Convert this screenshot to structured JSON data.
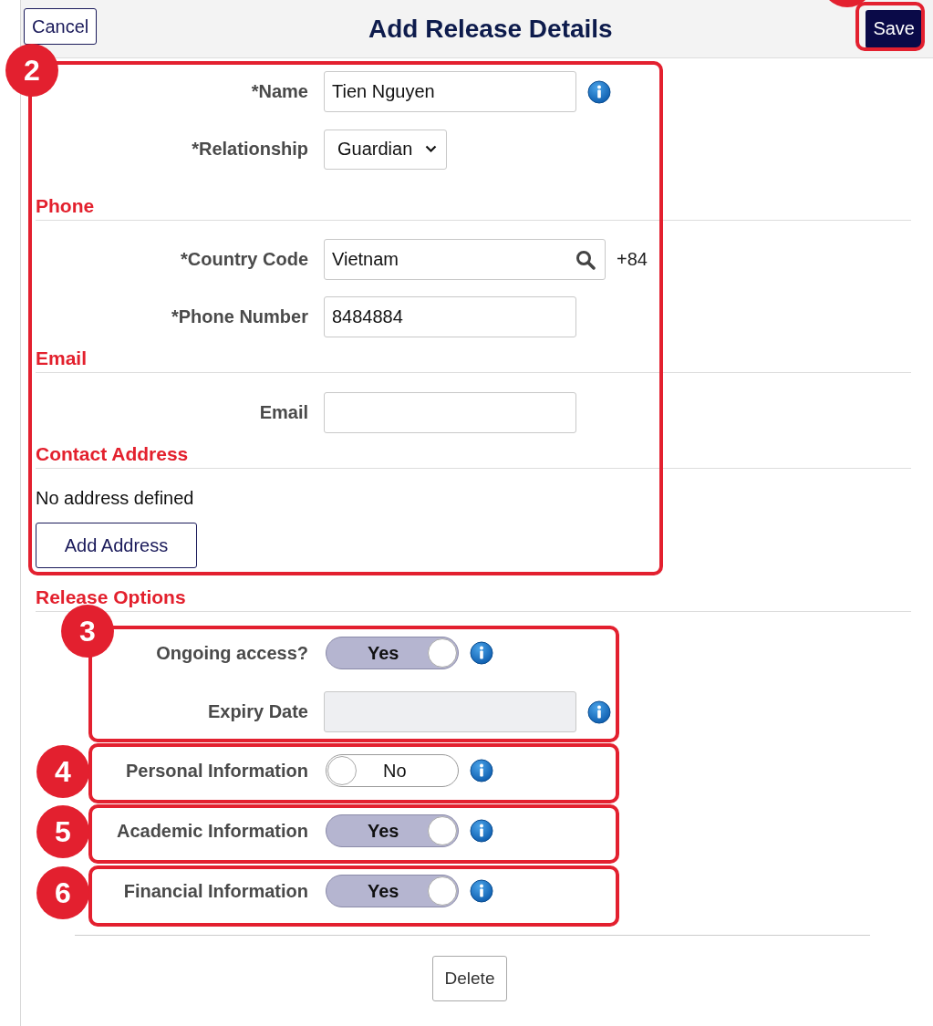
{
  "header": {
    "cancel": "Cancel",
    "title": "Add Release Details",
    "save": "Save",
    "save_highlighted": true
  },
  "form": [
    {
      "kind": "input",
      "label": "*Name",
      "value": "Tien Nguyen",
      "info": true
    },
    {
      "kind": "select",
      "label": "*Relationship",
      "value": "Guardian"
    },
    {
      "kind": "heading",
      "text": "Phone"
    },
    {
      "kind": "lookup",
      "label": "*Country Code",
      "value": "Vietnam",
      "suffix": "+84"
    },
    {
      "kind": "input",
      "label": "*Phone Number",
      "value": "8484884",
      "info": false
    },
    {
      "kind": "heading",
      "text": "Email"
    },
    {
      "kind": "input",
      "label": "Email",
      "info": false
    },
    {
      "kind": "heading",
      "text": "Contact Address"
    },
    {
      "kind": "note",
      "text": "No address defined"
    },
    {
      "kind": "button",
      "text": "Add Address"
    },
    {
      "kind": "heading",
      "text": "Release Options"
    },
    {
      "kind": "toggle",
      "label": "Ongoing access?",
      "on": true,
      "text": "Yes"
    },
    {
      "kind": "input",
      "label": "Expiry Date",
      "disabled": true,
      "info": true
    },
    {
      "kind": "toggle",
      "label": "Personal Information",
      "on": false,
      "text": "No"
    },
    {
      "kind": "toggle",
      "label": "Academic Information",
      "on": true,
      "text": "Yes"
    },
    {
      "kind": "toggle",
      "label": "Financial Information",
      "on": true,
      "text": "Yes"
    }
  ],
  "delete": "Delete",
  "annotations": [
    {
      "number": "2"
    },
    {
      "number": "3"
    },
    {
      "number": "4"
    },
    {
      "number": "5"
    },
    {
      "number": "6"
    }
  ]
}
